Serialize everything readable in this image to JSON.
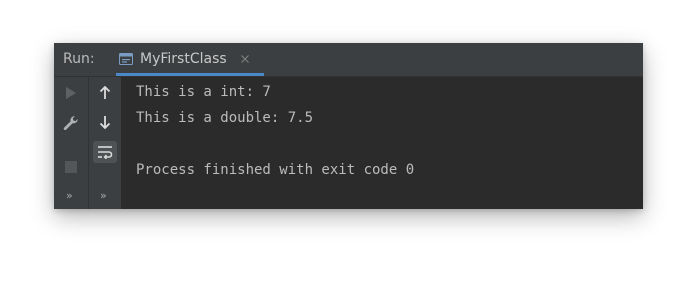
{
  "header": {
    "run_label": "Run:",
    "tab": {
      "title": "MyFirstClass",
      "icon": "java-class-icon",
      "close_icon": "close-icon",
      "accent": "#4a88c7"
    }
  },
  "toolbar_left": {
    "items": [
      "rerun-icon",
      "settings-icon",
      "stop-icon",
      "more-icon"
    ],
    "more_glyph": "»"
  },
  "toolbar_right": {
    "items": [
      "up-arrow-icon",
      "down-arrow-icon",
      "soft-wrap-icon",
      "more-icon"
    ],
    "more_glyph": "»"
  },
  "console": {
    "lines": [
      "This is a int: 7",
      "This is a double: 7.5",
      "",
      "Process finished with exit code 0"
    ]
  },
  "colors": {
    "console_bg": "#2b2b2b",
    "panel_bg": "#3c3f41",
    "text": "#bbbbbb"
  }
}
